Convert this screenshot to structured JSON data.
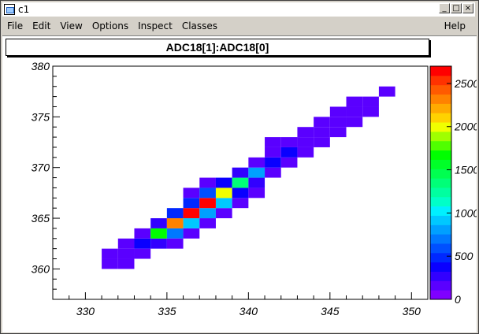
{
  "window": {
    "title": "c1",
    "min_label": "_",
    "max_label": "□",
    "close_label": "×"
  },
  "menu": {
    "file": "File",
    "edit": "Edit",
    "view": "View",
    "options": "Options",
    "inspect": "Inspect",
    "classes": "Classes",
    "help": "Help"
  },
  "histogram": {
    "title": "ADC18[1]:ADC18[0]"
  },
  "colors": {
    "palette": [
      "#7f00ff",
      "#5a00ff",
      "#3200ff",
      "#0a00ff",
      "#0028ff",
      "#0050ff",
      "#0078ff",
      "#00a0ff",
      "#00c8ff",
      "#00f0ff",
      "#00ffc8",
      "#00ffa0",
      "#00ff78",
      "#00ff50",
      "#00ff28",
      "#00ff00",
      "#50ff00",
      "#a0ff00",
      "#f0ff00",
      "#ffd200",
      "#ffaa00",
      "#ff8200",
      "#ff5a00",
      "#ff3200",
      "#ff0000"
    ]
  },
  "chart_data": {
    "type": "heatmap",
    "xlim": [
      328,
      351
    ],
    "ylim": [
      357,
      380
    ],
    "x_ticks": [
      330,
      335,
      340,
      345,
      350
    ],
    "y_ticks": [
      360,
      365,
      370,
      375,
      380
    ],
    "z_range": [
      0,
      2700
    ],
    "z_ticks": [
      0,
      500,
      1000,
      1500,
      2000,
      2500
    ],
    "z_tick_labels": [
      "0",
      "500",
      "1000",
      "1500",
      "2000",
      "2500"
    ],
    "bin_width": 1,
    "cells": [
      {
        "x": 331,
        "y": 361,
        "z": 150
      },
      {
        "x": 332,
        "y": 361,
        "z": 150
      },
      {
        "x": 331,
        "y": 360,
        "z": 150
      },
      {
        "x": 332,
        "y": 360,
        "z": 150
      },
      {
        "x": 332,
        "y": 362,
        "z": 150
      },
      {
        "x": 333,
        "y": 362,
        "z": 400
      },
      {
        "x": 334,
        "y": 362,
        "z": 250
      },
      {
        "x": 333,
        "y": 361,
        "z": 150
      },
      {
        "x": 333,
        "y": 363,
        "z": 150
      },
      {
        "x": 334,
        "y": 363,
        "z": 1700
      },
      {
        "x": 335,
        "y": 363,
        "z": 750
      },
      {
        "x": 336,
        "y": 363,
        "z": 150
      },
      {
        "x": 334,
        "y": 364,
        "z": 300
      },
      {
        "x": 335,
        "y": 364,
        "z": 2300
      },
      {
        "x": 336,
        "y": 364,
        "z": 950
      },
      {
        "x": 337,
        "y": 364,
        "z": 150
      },
      {
        "x": 335,
        "y": 362,
        "z": 150
      },
      {
        "x": 335,
        "y": 365,
        "z": 500
      },
      {
        "x": 336,
        "y": 365,
        "z": 2700
      },
      {
        "x": 337,
        "y": 365,
        "z": 800
      },
      {
        "x": 338,
        "y": 365,
        "z": 150
      },
      {
        "x": 336,
        "y": 366,
        "z": 500
      },
      {
        "x": 337,
        "y": 366,
        "z": 2700
      },
      {
        "x": 338,
        "y": 366,
        "z": 900
      },
      {
        "x": 339,
        "y": 366,
        "z": 150
      },
      {
        "x": 336,
        "y": 367,
        "z": 150
      },
      {
        "x": 337,
        "y": 367,
        "z": 600
      },
      {
        "x": 338,
        "y": 367,
        "z": 2000
      },
      {
        "x": 339,
        "y": 367,
        "z": 400
      },
      {
        "x": 340,
        "y": 367,
        "z": 150
      },
      {
        "x": 337,
        "y": 368,
        "z": 150
      },
      {
        "x": 338,
        "y": 368,
        "z": 400
      },
      {
        "x": 339,
        "y": 368,
        "z": 1400
      },
      {
        "x": 340,
        "y": 368,
        "z": 300
      },
      {
        "x": 339,
        "y": 369,
        "z": 300
      },
      {
        "x": 340,
        "y": 369,
        "z": 800
      },
      {
        "x": 341,
        "y": 369,
        "z": 150
      },
      {
        "x": 340,
        "y": 370,
        "z": 150
      },
      {
        "x": 341,
        "y": 370,
        "z": 350
      },
      {
        "x": 342,
        "y": 370,
        "z": 150
      },
      {
        "x": 341,
        "y": 371,
        "z": 150
      },
      {
        "x": 342,
        "y": 371,
        "z": 350
      },
      {
        "x": 343,
        "y": 371,
        "z": 150
      },
      {
        "x": 341,
        "y": 372,
        "z": 150
      },
      {
        "x": 342,
        "y": 372,
        "z": 150
      },
      {
        "x": 343,
        "y": 372,
        "z": 200
      },
      {
        "x": 344,
        "y": 372,
        "z": 150
      },
      {
        "x": 343,
        "y": 373,
        "z": 150
      },
      {
        "x": 344,
        "y": 373,
        "z": 150
      },
      {
        "x": 345,
        "y": 373,
        "z": 150
      },
      {
        "x": 344,
        "y": 374,
        "z": 150
      },
      {
        "x": 345,
        "y": 374,
        "z": 150
      },
      {
        "x": 346,
        "y": 374,
        "z": 150
      },
      {
        "x": 345,
        "y": 375,
        "z": 150
      },
      {
        "x": 346,
        "y": 375,
        "z": 150
      },
      {
        "x": 347,
        "y": 375,
        "z": 150
      },
      {
        "x": 346,
        "y": 376,
        "z": 150
      },
      {
        "x": 347,
        "y": 376,
        "z": 150
      },
      {
        "x": 348,
        "y": 377,
        "z": 150
      }
    ]
  }
}
